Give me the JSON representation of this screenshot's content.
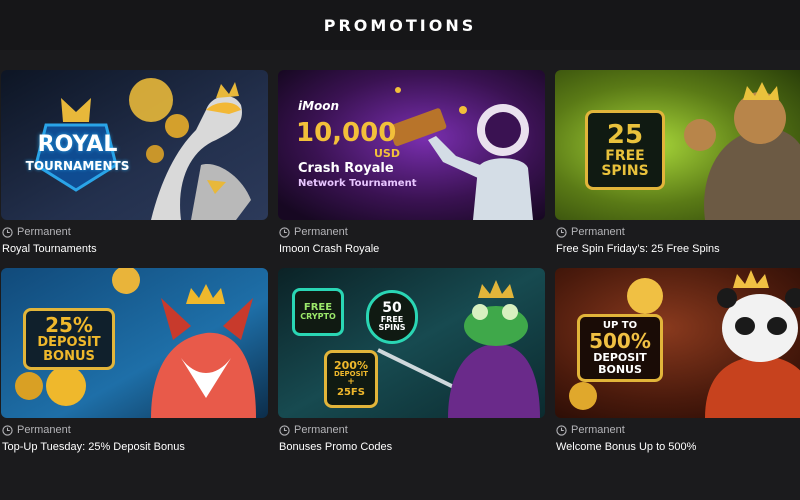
{
  "page": {
    "title": "PROMOTIONS"
  },
  "promotions": [
    {
      "tag": "Permanent",
      "title": "Royal Tournaments",
      "banner": {
        "lines": [
          "ROYAL",
          "TOURNAMENTS"
        ],
        "icon": "eagle-with-crown",
        "colors": {
          "bg": "#1f2a44",
          "accent": "#2aa4e8",
          "gold": "#e8b83a"
        }
      }
    },
    {
      "tag": "Permanent",
      "title": "Imoon Crash Royale",
      "banner": {
        "brand": "iMoon",
        "amount": "10,000",
        "currency": "USD",
        "lines": [
          "Crash Royale",
          "Network Tournament"
        ],
        "icon": "astronaut",
        "colors": {
          "bg": "#2a0f3a",
          "accent": "#c45cf2",
          "gold": "#f2c03a"
        }
      }
    },
    {
      "tag": "Permanent",
      "title": "Free Spin Friday’s: 25 Free Spins",
      "banner": {
        "lines": [
          "25",
          "FREE",
          "SPINS"
        ],
        "icon": "lion-warrior",
        "colors": {
          "bg": "#5a7a16",
          "accent": "#9bd62a",
          "gold": "#e9c23c"
        }
      }
    },
    {
      "tag": "Permanent",
      "title": "Top-Up Tuesday: 25% Deposit Bonus",
      "banner": {
        "lines": [
          "25%",
          "DEPOSIT",
          "BONUS"
        ],
        "icon": "fox-king",
        "colors": {
          "bg": "#114a7a",
          "accent": "#2a9fd6",
          "gold": "#efb82c"
        }
      }
    },
    {
      "tag": "Permanent",
      "title": "Bonuses Promo Codes",
      "banner": {
        "badges": [
          {
            "lines": [
              "FREE",
              "CRYPTO"
            ]
          },
          {
            "lines": [
              "50",
              "FREE",
              "SPINS"
            ]
          },
          {
            "lines": [
              "200%",
              "DEPOSIT",
              "+",
              "25FS"
            ]
          }
        ],
        "icon": "frog-samurai",
        "colors": {
          "bg": "#0f3a3f",
          "accent": "#2ad6b4",
          "gold": "#e2b53a"
        }
      }
    },
    {
      "tag": "Permanent",
      "title": "Welcome Bonus Up to 500%",
      "banner": {
        "lines": [
          "UP TO",
          "500%",
          "DEPOSIT",
          "BONUS"
        ],
        "icon": "panda-king",
        "colors": {
          "bg": "#5a1d0f",
          "accent": "#c7421e",
          "gold": "#f0c043"
        }
      }
    }
  ]
}
